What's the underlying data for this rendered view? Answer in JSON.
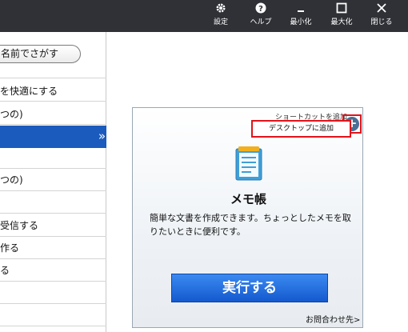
{
  "toolbar": {
    "settings_label": "設定",
    "help_label": "ヘルプ",
    "minimize_label": "最小化",
    "maximize_label": "最大化",
    "close_label": "閉じる"
  },
  "left_panel": {
    "search_button_label": "名前でさがす",
    "items": [
      {
        "label": "を快適にする"
      },
      {
        "label": "つの)"
      },
      {
        "label": ""
      },
      {
        "label": ""
      },
      {
        "label": "つの)"
      },
      {
        "label": ""
      },
      {
        "label": "受信する"
      },
      {
        "label": "作る"
      },
      {
        "label": "る"
      }
    ],
    "selected_index": 2,
    "selected_chevron": "»"
  },
  "card": {
    "shortcut_label": "ショートカットを追加",
    "add_button_symbol": "+",
    "popup_label": "デスクトップに追加",
    "app_title": "メモ帳",
    "description": "簡単な文書を作成できます。ちょっとしたメモを取りたいときに便利です。",
    "run_button_label": "実行する",
    "contact_link": "お問合わせ先>"
  },
  "colors": {
    "toolbar_bg": "#2f3136",
    "selected_row": "#1b5bbd",
    "run_button": "#1f6ee0",
    "highlight_frame": "#e0141a"
  }
}
